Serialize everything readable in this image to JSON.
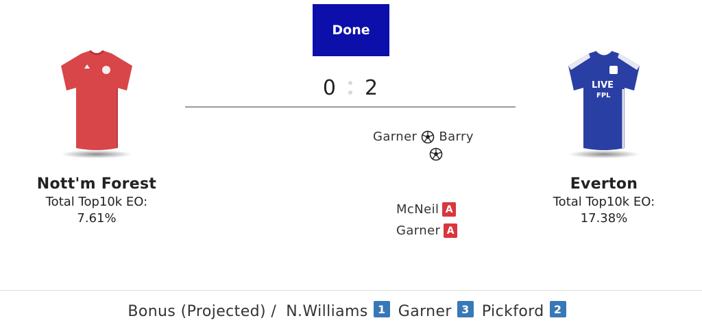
{
  "header": {
    "done_label": "Done"
  },
  "score": {
    "home": "0",
    "away": "2"
  },
  "home_team": {
    "name": "Nott'm Forest",
    "eo_label": "Total Top10k EO:",
    "eo_value": "7.61%",
    "shirt_color": "#d8464a"
  },
  "away_team": {
    "name": "Everton",
    "eo_label": "Total Top10k EO:",
    "eo_value": "17.38%",
    "shirt_color": "#2a3fa3",
    "shirt_text_1": "LIVE",
    "shirt_text_2": "FPL"
  },
  "goals": [
    {
      "scorer": "Garner",
      "assist": "Barry",
      "icon": "football-icon"
    },
    {
      "icon": "football-icon"
    }
  ],
  "cards": [
    {
      "player": "McNeil",
      "badge": "A"
    },
    {
      "player": "Garner",
      "badge": "A"
    }
  ],
  "colors": {
    "done": "#0c0fa9",
    "card": "#d9363e",
    "bonus": "#3978b6"
  },
  "bonus": {
    "label": "Bonus (Projected) /",
    "items": [
      {
        "player": "N.Williams",
        "points": "1"
      },
      {
        "player": "Garner",
        "points": "3"
      },
      {
        "player": "Pickford",
        "points": "2"
      }
    ]
  }
}
